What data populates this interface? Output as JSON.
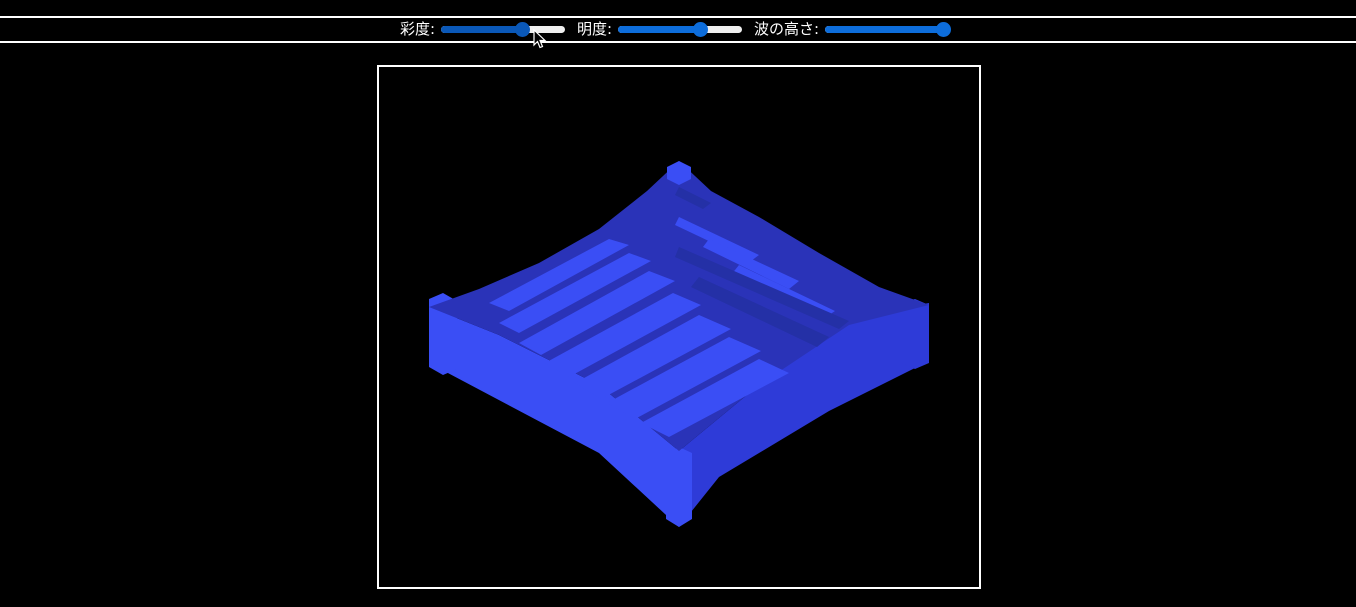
{
  "controls": [
    {
      "label": "彩度:",
      "value": 0.67,
      "active": true
    },
    {
      "label": "明度:",
      "value": 0.68,
      "active": false
    },
    {
      "label": "波の高さ:",
      "value": 1.0,
      "active": false
    }
  ],
  "colors": {
    "background": "#000000",
    "frame": "#ffffff",
    "slider_fill": "#0d6ddb",
    "slider_track": "#efefef",
    "surface_top": "#2a33b8",
    "surface_left": "#3a4ef5",
    "surface_right": "#2e3bd8"
  },
  "icons": {
    "cursor": "mouse-pointer-icon"
  }
}
